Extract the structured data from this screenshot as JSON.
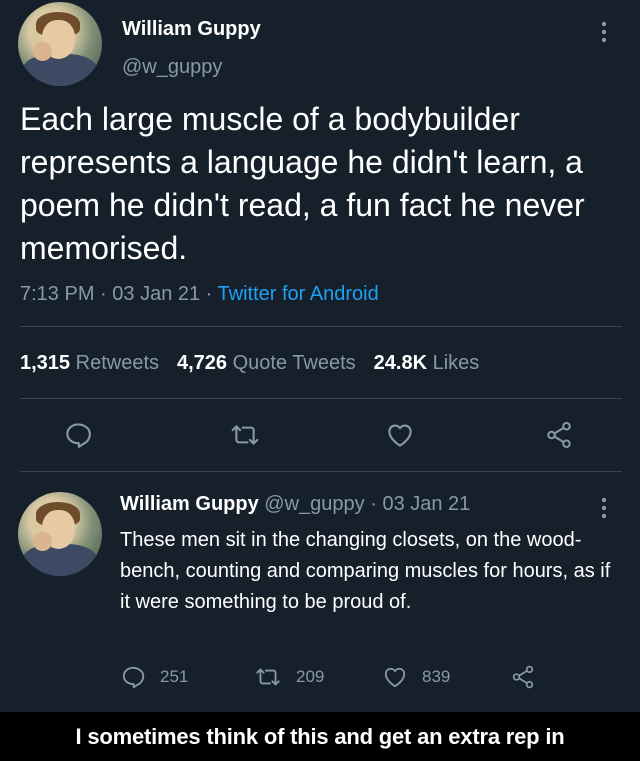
{
  "main_tweet": {
    "author_name": "William Guppy",
    "author_handle": "@w_guppy",
    "text": "Each large muscle of a bodybuilder represents a language he didn't learn, a poem he didn't read, a fun fact he never memorised.",
    "time": "7:13 PM",
    "date": "03 Jan 21",
    "separator": " · ",
    "source": "Twitter for Android",
    "retweets_count": "1,315",
    "retweets_label": "Retweets",
    "quote_count": "4,726",
    "quote_label": "Quote Tweets",
    "likes_count": "24.8K",
    "likes_label": "Likes",
    "icons": [
      "more-vertical-icon",
      "reply-icon",
      "retweet-icon",
      "like-icon",
      "share-icon"
    ]
  },
  "reply_tweet": {
    "author_name": "William Guppy",
    "author_handle": "@w_guppy",
    "separator": " · ",
    "date": "03 Jan 21",
    "text": "These men sit in the changing closets, on the wood-bench, counting and comparing muscles for hours, as if it were something to be proud of.",
    "reply_count": "251",
    "retweet_count": "209",
    "like_count": "839"
  },
  "caption": "I sometimes think of this and get an extra rep in",
  "colors": {
    "background": "#15202b",
    "text": "#ffffff",
    "muted": "#8899a6",
    "link": "#1da1f2",
    "divider": "#38444d",
    "caption_bar": "#000000"
  }
}
